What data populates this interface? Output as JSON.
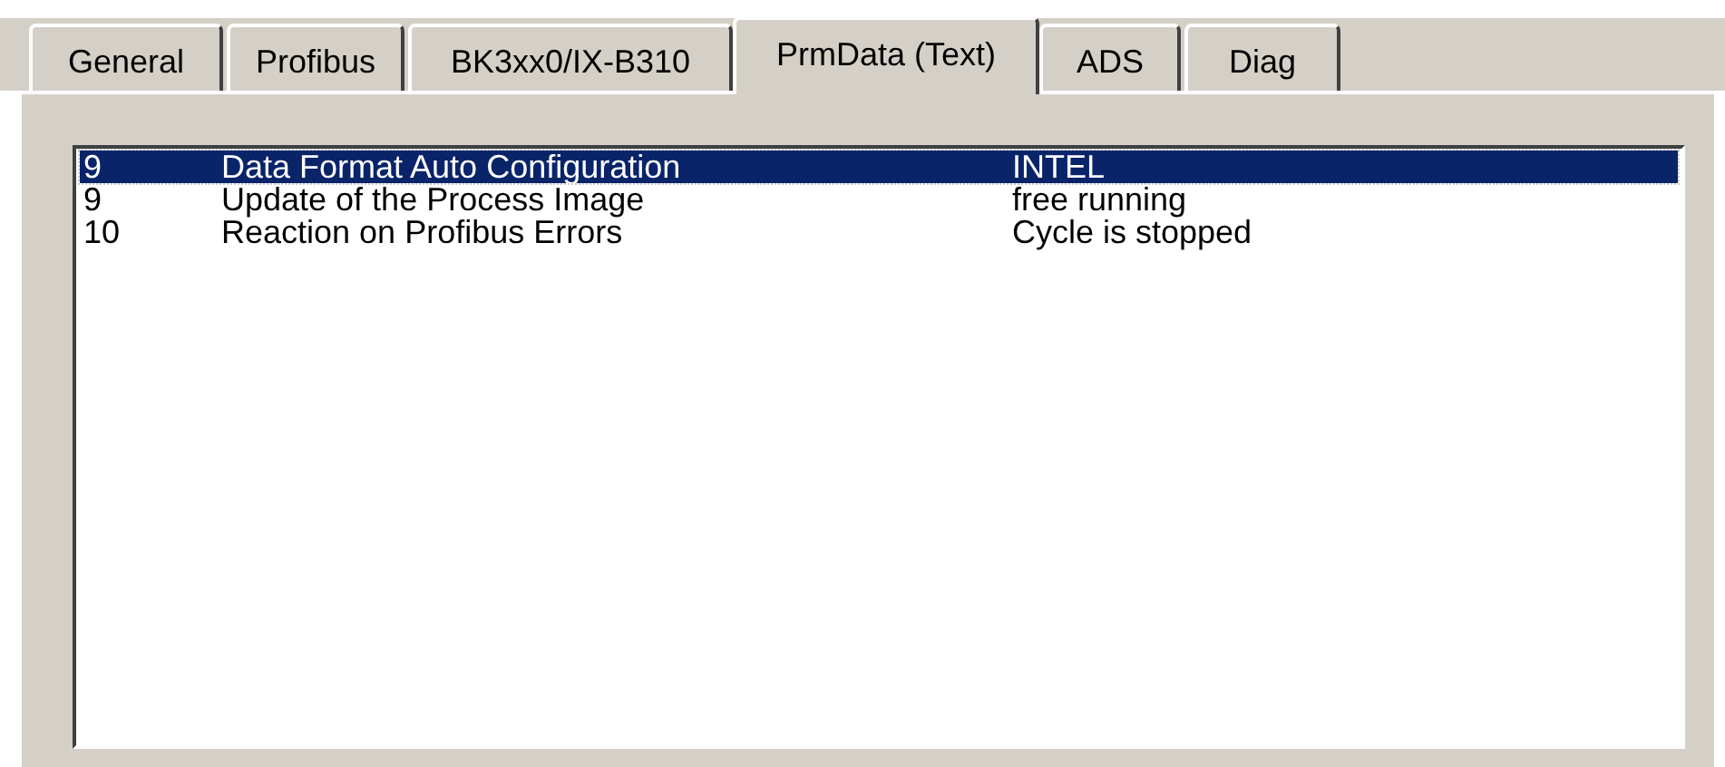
{
  "tabs": [
    {
      "label": "General",
      "selected": false
    },
    {
      "label": "Profibus",
      "selected": false
    },
    {
      "label": "BK3xx0/IX-B310",
      "selected": false
    },
    {
      "label": "PrmData (Text)",
      "selected": true
    },
    {
      "label": "ADS",
      "selected": false
    },
    {
      "label": "Diag",
      "selected": false
    }
  ],
  "list": {
    "rows": [
      {
        "cells": [
          "9",
          "Data Format Auto Configuration",
          "INTEL"
        ],
        "selected": true
      },
      {
        "cells": [
          "9",
          "Update of the Process Image",
          "free running"
        ],
        "selected": false
      },
      {
        "cells": [
          "10",
          "Reaction on Profibus Errors",
          "Cycle is stopped"
        ],
        "selected": false
      }
    ]
  }
}
